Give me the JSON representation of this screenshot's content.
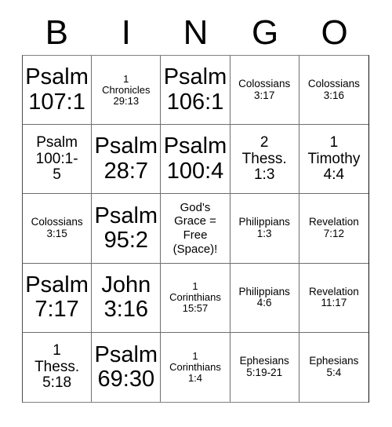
{
  "card": {
    "header_letters": [
      "B",
      "I",
      "N",
      "G",
      "O"
    ],
    "rows": [
      [
        {
          "text": "Psalm\n107:1",
          "size": "lg"
        },
        {
          "text": "1\nChronicles\n29:13",
          "size": "xs"
        },
        {
          "text": "Psalm\n106:1",
          "size": "lg"
        },
        {
          "text": "Colossians\n3:17",
          "size": "sm"
        },
        {
          "text": "Colossians\n3:16",
          "size": "sm"
        }
      ],
      [
        {
          "text": "Psalm\n100:1-\n5",
          "size": "md"
        },
        {
          "text": "Psalm\n28:7",
          "size": "lg"
        },
        {
          "text": "Psalm\n100:4",
          "size": "lg"
        },
        {
          "text": "2\nThess.\n1:3",
          "size": "md"
        },
        {
          "text": "1\nTimothy\n4:4",
          "size": "md"
        }
      ],
      [
        {
          "text": "Colossians\n3:15",
          "size": "sm"
        },
        {
          "text": "Psalm\n95:2",
          "size": "lg"
        },
        {
          "text": "God's\nGrace =\nFree\n(Space)!",
          "size": "free"
        },
        {
          "text": "Philippians\n1:3",
          "size": "sm"
        },
        {
          "text": "Revelation\n7:12",
          "size": "sm"
        }
      ],
      [
        {
          "text": "Psalm\n7:17",
          "size": "lg"
        },
        {
          "text": "John\n3:16",
          "size": "lg"
        },
        {
          "text": "1\nCorinthians\n15:57",
          "size": "xs"
        },
        {
          "text": "Philippians\n4:6",
          "size": "sm"
        },
        {
          "text": "Revelation\n11:17",
          "size": "sm"
        }
      ],
      [
        {
          "text": "1\nThess.\n5:18",
          "size": "md"
        },
        {
          "text": "Psalm\n69:30",
          "size": "lg"
        },
        {
          "text": "1\nCorinthians\n1:4",
          "size": "xs"
        },
        {
          "text": "Ephesians\n5:19-21",
          "size": "sm"
        },
        {
          "text": "Ephesians\n5:4",
          "size": "sm"
        }
      ]
    ],
    "free_space": {
      "row": 2,
      "col": 2,
      "label": "God's Grace = Free (Space)!"
    },
    "colors": {
      "background": "#ffffff",
      "text": "#000000",
      "grid_line": "#6e6e6e"
    }
  }
}
